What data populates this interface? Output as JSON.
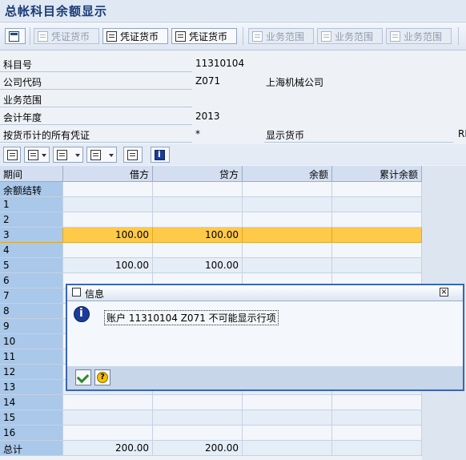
{
  "window": {
    "title": "总帐科目余额显示"
  },
  "toolbar": {
    "btn1": "凭证货币",
    "btn2": "凭证货币",
    "btn3": "凭证货币",
    "btn4": "业务范围",
    "btn5": "业务范围",
    "btn6": "业务范围"
  },
  "form": {
    "account_label": "科目号",
    "account_value": "11310104",
    "company_label": "公司代码",
    "company_value": "Z071",
    "company_name": "上海机械公司",
    "business_area_label": "业务范围",
    "fiscal_year_label": "会计年度",
    "fiscal_year_value": "2013",
    "all_vouchers_label": "按货币计的所有凭证",
    "all_vouchers_value": "*",
    "display_currency_label": "显示货币",
    "display_currency_value": "RM"
  },
  "grid": {
    "headers": {
      "period": "期间",
      "debit": "借方",
      "credit": "贷方",
      "balance": "余额",
      "cumulative": "累计余额"
    },
    "rows": [
      {
        "period": "余额结转",
        "debit": "",
        "credit": "",
        "balance": "",
        "cumulative": ""
      },
      {
        "period": "1",
        "debit": "",
        "credit": "",
        "balance": "",
        "cumulative": ""
      },
      {
        "period": "2",
        "debit": "",
        "credit": "",
        "balance": "",
        "cumulative": ""
      },
      {
        "period": "3",
        "debit": "100.00",
        "credit": "100.00",
        "balance": "",
        "cumulative": ""
      },
      {
        "period": "4",
        "debit": "",
        "credit": "",
        "balance": "",
        "cumulative": ""
      },
      {
        "period": "5",
        "debit": "100.00",
        "credit": "100.00",
        "balance": "",
        "cumulative": ""
      },
      {
        "period": "6",
        "debit": "",
        "credit": "",
        "balance": "",
        "cumulative": ""
      },
      {
        "period": "7",
        "debit": "",
        "credit": "",
        "balance": "",
        "cumulative": ""
      },
      {
        "period": "8",
        "debit": "",
        "credit": "",
        "balance": "",
        "cumulative": ""
      },
      {
        "period": "9",
        "debit": "",
        "credit": "",
        "balance": "",
        "cumulative": ""
      },
      {
        "period": "10",
        "debit": "",
        "credit": "",
        "balance": "",
        "cumulative": ""
      },
      {
        "period": "11",
        "debit": "",
        "credit": "",
        "balance": "",
        "cumulative": ""
      },
      {
        "period": "12",
        "debit": "",
        "credit": "",
        "balance": "",
        "cumulative": ""
      },
      {
        "period": "13",
        "debit": "",
        "credit": "",
        "balance": "",
        "cumulative": ""
      },
      {
        "period": "14",
        "debit": "",
        "credit": "",
        "balance": "",
        "cumulative": ""
      },
      {
        "period": "15",
        "debit": "",
        "credit": "",
        "balance": "",
        "cumulative": ""
      },
      {
        "period": "16",
        "debit": "",
        "credit": "",
        "balance": "",
        "cumulative": ""
      },
      {
        "period": "总计",
        "debit": "200.00",
        "credit": "200.00",
        "balance": "",
        "cumulative": ""
      }
    ]
  },
  "dialog": {
    "title": "信息",
    "message": "账户 11310104 Z071 不可能显示行项",
    "help_glyph": "?"
  },
  "colors": {
    "selected_row": "#ffc94a",
    "key_column": "#a9c8ea",
    "dialog_border": "#3a67b0"
  }
}
